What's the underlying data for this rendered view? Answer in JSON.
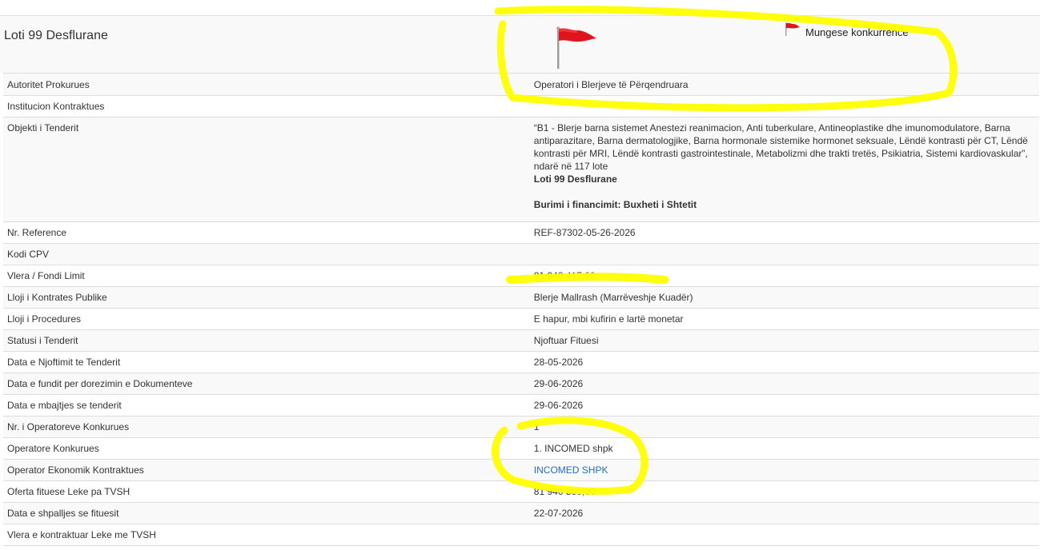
{
  "page_title": "Loti 99 Desflurane",
  "flag_legend": {
    "label": "Mungese konkurrence",
    "flag_icon": "red-flag-icon"
  },
  "colors": {
    "flag": "#e0141c",
    "highlight": "#ffff00",
    "link": "#1f6fbf"
  },
  "rows": [
    {
      "label": "Autoritet Prokurues",
      "value": "Operatori i Blerjeve të Përqendruara"
    },
    {
      "label": "Institucion Kontraktues",
      "value": ""
    },
    {
      "label": "Objekti i Tenderit",
      "value_text": "“B1 - Blerje barna sistemet Anestezi reanimacion, Anti tuberkulare, Antineoplastike dhe imunomodulatore, Barna antiparazitare, Barna dermatologjike, Barna hormonale sistemike hormonet seksuale, Lëndë kontrasti për CT, Lëndë kontrasti për MRI, Lëndë kontrasti gastrointestinale, Metabolizmi dhe trakti tretës, Psikiatria, Sistemi kardiovaskular”, ndarë në 117 lote",
      "value_lot": "Loti 99 Desflurane",
      "value_funding": "Burimi i financimit: Buxheti i Shtetit"
    },
    {
      "label": "Nr. Reference",
      "value": "REF-87302-05-26-2026"
    },
    {
      "label": "Kodi CPV",
      "value": ""
    },
    {
      "label": "Vlera / Fondi Limit",
      "value": "81 948 417,00"
    },
    {
      "label": "Lloji i Kontrates Publike",
      "value": "Blerje Mallrash (Marrëveshje Kuadër)"
    },
    {
      "label": "Lloji i Procedures",
      "value": "E hapur, mbi kufirin e lartë monetar"
    },
    {
      "label": "Statusi i Tenderit",
      "value": "Njoftuar Fituesi"
    },
    {
      "label": "Data e Njoftimit te Tenderit",
      "value": "28-05-2026"
    },
    {
      "label": "Data e fundit per dorezimin e Dokumenteve",
      "value": "29-06-2026"
    },
    {
      "label": "Data e mbajtjes se tenderit",
      "value": "29-06-2026"
    },
    {
      "label": "Nr. i Operatoreve Konkurues",
      "value": "1"
    },
    {
      "label": "Operatore Konkurues",
      "value": "1. INCOMED shpk"
    },
    {
      "label": "Operator Ekonomik Kontraktues",
      "value": "INCOMED SHPK"
    },
    {
      "label": "Oferta fituese Leke pa TVSH",
      "value": "81 940 500,00"
    },
    {
      "label": "Data e shpalljes se fituesit",
      "value": "22-07-2026"
    },
    {
      "label": "Vlera e kontraktuar Leke me TVSH",
      "value": ""
    }
  ]
}
